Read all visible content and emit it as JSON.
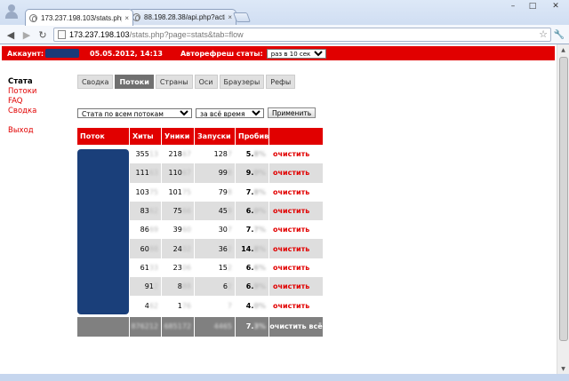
{
  "browser": {
    "tabs": [
      {
        "title": "173.237.198.103/stats.php?p",
        "active": true,
        "close": "×"
      },
      {
        "title": "88.198.28.38/api.php?action",
        "active": false,
        "close": "×"
      }
    ],
    "address": {
      "host": "173.237.198.103",
      "path": "/stats.php?page=stats&tab=flow"
    },
    "icons": [
      "back-icon",
      "forward-icon",
      "reload-icon",
      "star-icon",
      "wrench-icon"
    ],
    "window_buttons": {
      "minimize": "–",
      "maximize": "□",
      "close": "✕"
    }
  },
  "topbar": {
    "account_label": "Аккаунт:",
    "date": "05.05.2012, 14:13",
    "refresh_label": "Авторефреш статы:",
    "refresh_value": "раз в 10 сек",
    "color": "#e10000"
  },
  "sidebar": {
    "items": [
      "Стата",
      "Потоки",
      "FAQ",
      "Сводка"
    ],
    "exit": "Выход",
    "current": "Стата"
  },
  "subtabs": [
    "Сводка",
    "Потоки",
    "Страны",
    "Оси",
    "Браузеры",
    "Рефы"
  ],
  "active_subtab": "Потоки",
  "filters": {
    "flow_select": "Стата по всем потокам",
    "time_select": "за всё время",
    "apply_button": "Применить"
  },
  "table": {
    "headers": [
      "Поток",
      "Хиты",
      "Уники",
      "Запуски",
      "Пробив",
      ""
    ],
    "rows": [
      {
        "hits": "355",
        "hits_blur": "13",
        "uniq": "218",
        "uniq_blur": "67",
        "runs": "128",
        "runs_blur": "7",
        "pen": "5.",
        "pen_blur": "8%",
        "action": "очистить"
      },
      {
        "hits": "111",
        "hits_blur": "63",
        "uniq": "110",
        "uniq_blur": "67",
        "runs": "99",
        "runs_blur": "8",
        "pen": "9.",
        "pen_blur": "0%",
        "action": "очистить"
      },
      {
        "hits": "103",
        "hits_blur": "75",
        "uniq": "101",
        "uniq_blur": "75",
        "runs": "79",
        "runs_blur": "8",
        "pen": "7.",
        "pen_blur": "8%",
        "action": "очистить"
      },
      {
        "hits": "83",
        "hits_blur": "62",
        "uniq": "75",
        "uniq_blur": "66",
        "runs": "45",
        "runs_blur": "9",
        "pen": "6.",
        "pen_blur": "0%",
        "action": "очистить"
      },
      {
        "hits": "86",
        "hits_blur": "69",
        "uniq": "39",
        "uniq_blur": "60",
        "runs": "30",
        "runs_blur": "7",
        "pen": "7.",
        "pen_blur": "7%",
        "action": "очистить"
      },
      {
        "hits": "60",
        "hits_blur": "88",
        "uniq": "24",
        "uniq_blur": "02",
        "runs": "36",
        "runs_blur": "2",
        "pen": "14.",
        "pen_blur": "8%",
        "action": "очистить"
      },
      {
        "hits": "61",
        "hits_blur": "33",
        "uniq": "23",
        "uniq_blur": "06",
        "runs": "15",
        "runs_blur": "2",
        "pen": "6.",
        "pen_blur": "6%",
        "action": "очистить"
      },
      {
        "hits": "91",
        "hits_blur": "2",
        "uniq": "8",
        "uniq_blur": "88",
        "runs": "6",
        "runs_blur": "2",
        "pen": "6.",
        "pen_blur": "9%",
        "action": "очистить"
      },
      {
        "hits": "4",
        "hits_blur": "62",
        "uniq": "1",
        "uniq_blur": "76",
        "runs": "",
        "runs_blur": "7",
        "pen": "4.",
        "pen_blur": "0%",
        "action": "очистить"
      }
    ],
    "total": {
      "hits_blur": "876212",
      "uniq_blur": "685172",
      "runs_blur": "4465",
      "pen": "7.",
      "pen_blur": "3%",
      "action": "очистить всё"
    }
  }
}
